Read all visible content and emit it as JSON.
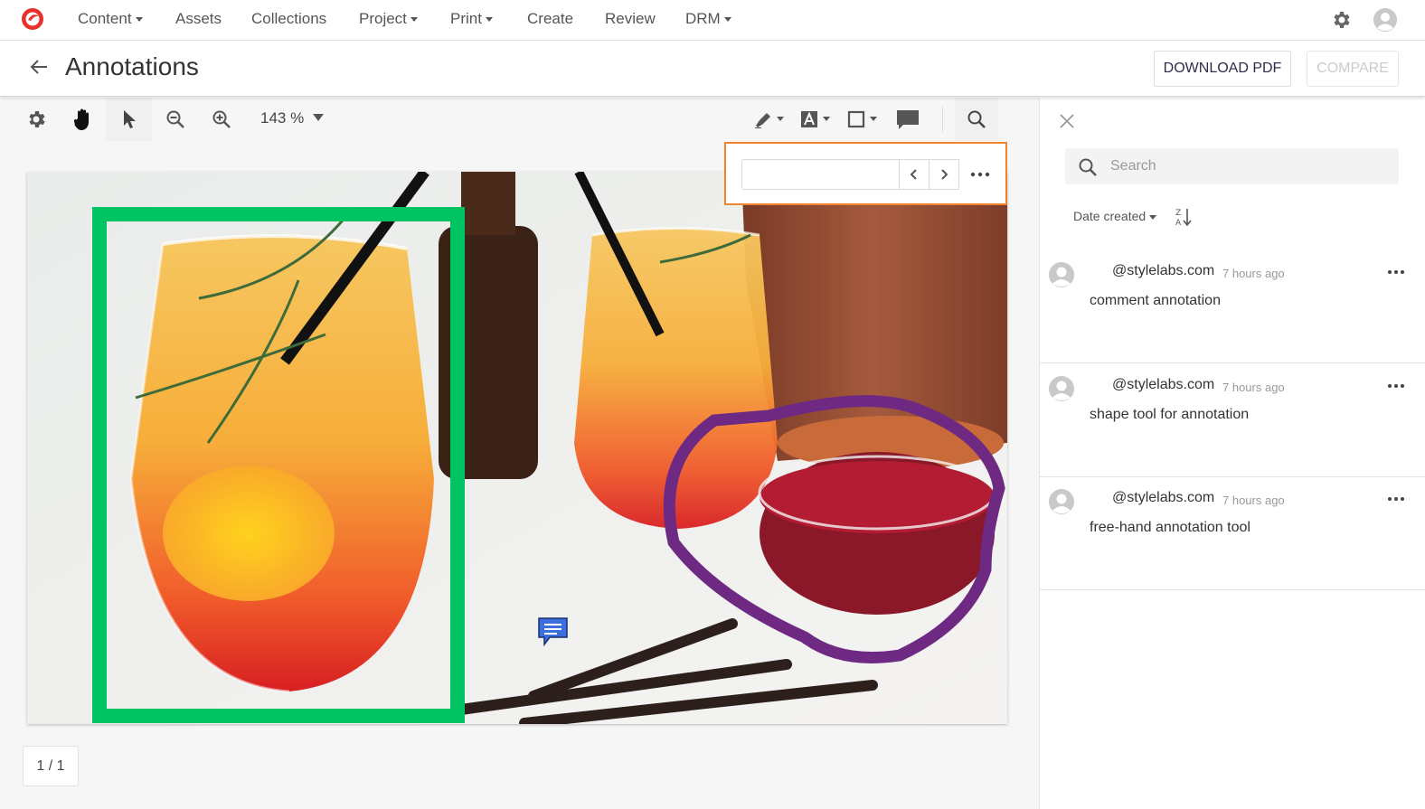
{
  "nav": {
    "items": [
      {
        "label": "Content",
        "dropdown": true
      },
      {
        "label": "Assets",
        "dropdown": false
      },
      {
        "label": "Collections",
        "dropdown": false
      },
      {
        "label": "Project",
        "dropdown": true
      },
      {
        "label": "Print",
        "dropdown": true
      },
      {
        "label": "Create",
        "dropdown": false
      },
      {
        "label": "Review",
        "dropdown": false
      },
      {
        "label": "DRM",
        "dropdown": true
      }
    ]
  },
  "header": {
    "title": "Annotations",
    "download_label": "DOWNLOAD PDF",
    "compare_label": "COMPARE"
  },
  "toolbar": {
    "zoom": "143 %"
  },
  "find": {
    "value": ""
  },
  "viewer": {
    "page_indicator": "1 / 1"
  },
  "panel": {
    "search_placeholder": "Search",
    "sort_label": "Date created"
  },
  "comments": [
    {
      "user": "@stylelabs.com",
      "time": "7 hours ago",
      "text": "comment annotation"
    },
    {
      "user": "@stylelabs.com",
      "time": "7 hours ago",
      "text": "shape tool for annotation"
    },
    {
      "user": "@stylelabs.com",
      "time": "7 hours ago",
      "text": "free-hand annotation tool"
    }
  ],
  "colors": {
    "brand": "#e8312c",
    "find_border": "#f0842c",
    "rect_annotation": "#00c462",
    "freehand_annotation": "#6e2a82",
    "comment_pin": "#3b6fe0"
  }
}
